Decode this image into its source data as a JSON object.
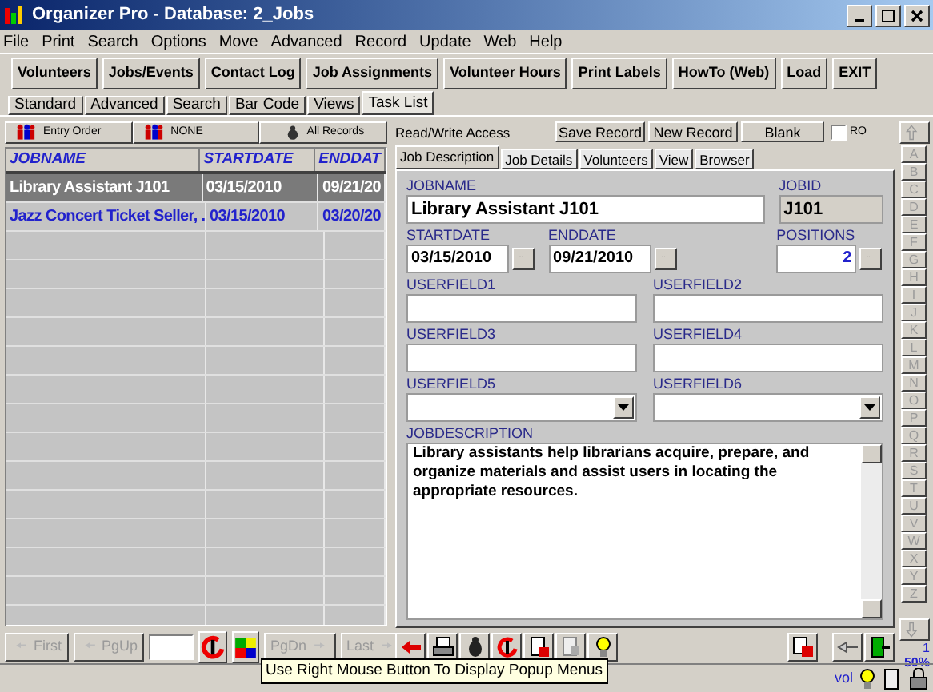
{
  "window": {
    "title": "Organizer Pro - Database: 2_Jobs"
  },
  "menu": [
    "File",
    "Print",
    "Search",
    "Options",
    "Move",
    "Advanced",
    "Record",
    "Update",
    "Web",
    "Help"
  ],
  "toolbar": [
    "Volunteers",
    "Jobs/Events",
    "Contact Log",
    "Job Assignments",
    "Volunteer Hours",
    "Print Labels",
    "HowTo (Web)",
    "Load",
    "EXIT"
  ],
  "view_tabs": [
    {
      "label": "Standard",
      "selected": false
    },
    {
      "label": "Advanced",
      "selected": false
    },
    {
      "label": "Search",
      "selected": false
    },
    {
      "label": "Bar Code",
      "selected": false
    },
    {
      "label": "Views",
      "selected": false
    },
    {
      "label": "Task List",
      "selected": true
    }
  ],
  "sort_bar": [
    "Entry Order",
    "NONE",
    "All Records"
  ],
  "grid": {
    "columns": [
      "JOBNAME",
      "STARTDATE",
      "ENDDAT"
    ],
    "rows": [
      {
        "cells": [
          "Library Assistant J101",
          "03/15/2010",
          "09/21/20"
        ],
        "selected": true
      },
      {
        "cells": [
          "Jazz Concert Ticket Seller, .",
          "03/15/2010",
          "03/20/20"
        ],
        "selected": false
      }
    ]
  },
  "nav": [
    {
      "label": "First",
      "disabled": true
    },
    {
      "label": "PgUp",
      "disabled": true
    },
    {
      "label": "PgDn",
      "disabled": true
    },
    {
      "label": "Last",
      "disabled": true
    }
  ],
  "record_bar": {
    "access": "Read/Write Access",
    "buttons": [
      "Save Record",
      "New Record",
      "Blank"
    ],
    "ro": {
      "label": "RO",
      "checked": false
    }
  },
  "form_tabs": [
    {
      "label": "Job Description",
      "selected": true
    },
    {
      "label": "Job Details",
      "selected": false
    },
    {
      "label": "Volunteers",
      "selected": false
    },
    {
      "label": "View",
      "selected": false
    },
    {
      "label": "Browser",
      "selected": false
    }
  ],
  "form": {
    "jobname": {
      "label": "JOBNAME",
      "value": "Library Assistant J101"
    },
    "jobid": {
      "label": "JOBID",
      "value": "J101"
    },
    "startdate": {
      "label": "STARTDATE",
      "value": "03/15/2010"
    },
    "enddate": {
      "label": "ENDDATE",
      "value": "09/21/2010"
    },
    "positions": {
      "label": "POSITIONS",
      "value": "2"
    },
    "userfields": [
      {
        "label": "USERFIELD1",
        "kind": "text"
      },
      {
        "label": "USERFIELD2",
        "kind": "text"
      },
      {
        "label": "USERFIELD3",
        "kind": "text"
      },
      {
        "label": "USERFIELD4",
        "kind": "text"
      },
      {
        "label": "USERFIELD5",
        "kind": "dropdown"
      },
      {
        "label": "USERFIELD6",
        "kind": "dropdown"
      }
    ],
    "description": {
      "label": "JOBDESCRIPTION",
      "value": "Library assistants help librarians acquire, prepare, and organize materials and assist users in locating the appropriate resources."
    }
  },
  "alphabet": {
    "disabled": true,
    "letters": [
      "A",
      "B",
      "C",
      "D",
      "E",
      "F",
      "G",
      "H",
      "I",
      "J",
      "K",
      "L",
      "M",
      "N",
      "O",
      "P",
      "Q",
      "R",
      "S",
      "T",
      "U",
      "V",
      "W",
      "X",
      "Y",
      "Z"
    ]
  },
  "status": {
    "page": "1",
    "zoom": "50%",
    "vol": "vol"
  },
  "tooltip": "Use Right Mouse Button To Display Popup Menus"
}
